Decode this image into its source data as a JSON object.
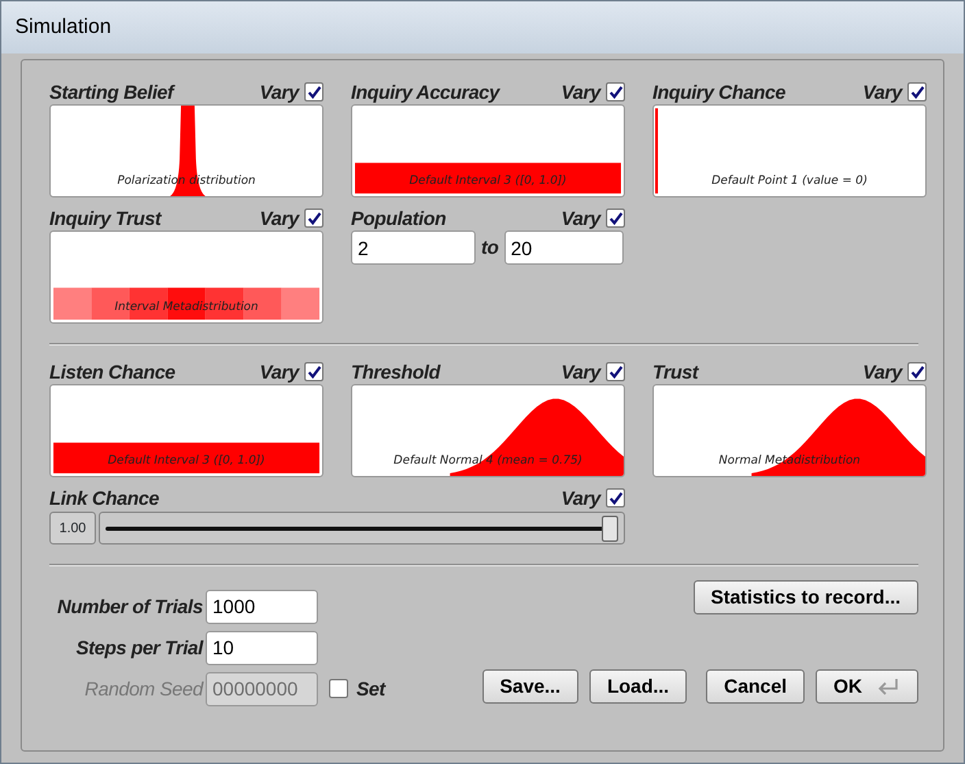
{
  "window": {
    "title": "Simulation"
  },
  "sections": [
    {
      "panels": [
        {
          "kind": "dist",
          "label": "Starting Belief",
          "vary_label": "Vary",
          "vary": true,
          "plot": {
            "kind": "peak"
          },
          "caption": "Polarization distribution"
        },
        {
          "kind": "dist",
          "label": "Inquiry Accuracy",
          "vary_label": "Vary",
          "vary": true,
          "plot": {
            "kind": "interval"
          },
          "caption": "Default Interval 3 ([0, 1.0])"
        },
        {
          "kind": "dist",
          "label": "Inquiry Chance",
          "vary_label": "Vary",
          "vary": true,
          "plot": {
            "kind": "point"
          },
          "caption": "Default Point 1 (value = 0)"
        },
        {
          "kind": "dist",
          "label": "Inquiry Trust",
          "vary_label": "Vary",
          "vary": true,
          "plot": {
            "kind": "metadist"
          },
          "caption": "Interval Metadistribution"
        },
        {
          "kind": "range",
          "label": "Population",
          "vary_label": "Vary",
          "vary": true,
          "from": "2",
          "joiner": "to",
          "to": "20"
        }
      ]
    },
    {
      "panels": [
        {
          "kind": "dist",
          "label": "Listen Chance",
          "vary_label": "Vary",
          "vary": true,
          "plot": {
            "kind": "interval"
          },
          "caption": "Default Interval 3 ([0, 1.0])"
        },
        {
          "kind": "dist",
          "label": "Threshold",
          "vary_label": "Vary",
          "vary": true,
          "plot": {
            "kind": "normal"
          },
          "caption": "Default Normal 4 (mean = 0.75)"
        },
        {
          "kind": "dist",
          "label": "Trust",
          "vary_label": "Vary",
          "vary": true,
          "plot": {
            "kind": "normal"
          },
          "caption": "Normal Metadistribution"
        },
        {
          "kind": "slider",
          "label": "Link Chance",
          "vary_label": "Vary",
          "vary": true,
          "reading": "1.00",
          "level": 1.0
        }
      ]
    }
  ],
  "fields": [
    {
      "label": "Number of Trials",
      "value": "1000",
      "disabled": false
    },
    {
      "label": "Steps per Trial",
      "value": "10",
      "disabled": false
    },
    {
      "label": "Random Seed",
      "value": "00000000",
      "disabled": true,
      "check_label": "Set",
      "checked": false
    }
  ],
  "stats_button": "Statistics to record...",
  "buttons": [
    {
      "label": "Save...",
      "kind": "plain"
    },
    {
      "label": "Load...",
      "kind": "plain"
    },
    {
      "label": "Cancel",
      "kind": "plain"
    },
    {
      "label": "OK",
      "kind": "default"
    }
  ]
}
